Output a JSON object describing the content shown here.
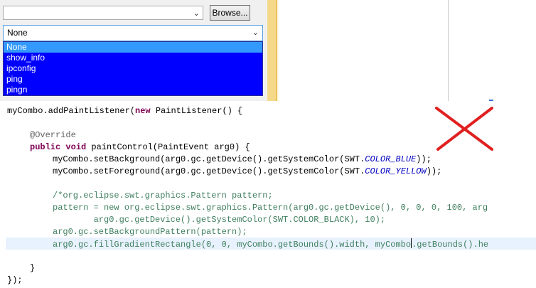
{
  "path_combo": {
    "value": "",
    "arrow": "⌄"
  },
  "browse_button": {
    "label": "Browse..."
  },
  "command_combo": {
    "selected": "None",
    "arrow": "⌄",
    "options": [
      "None",
      "show_info",
      "ipconfig",
      "ping",
      "pingn"
    ]
  },
  "colors": {
    "dropdown_background": "#0000ff",
    "dropdown_text": "#ffffff",
    "highlight": "#3399ff",
    "cross": "#e02020"
  },
  "cross_icon": "x-mark-icon",
  "code": {
    "line1": {
      "a": "myCombo.addPaintListener(",
      "kw": "new",
      "b": " PaintListener() {"
    },
    "line3": {
      "ann": "@Override"
    },
    "line4": {
      "kw1": "public",
      "kw2": "void",
      "b": " paintControl(PaintEvent arg0) {"
    },
    "line5": {
      "a": "myCombo.setBackground(arg0.gc.getDevice().getSystemColor(SWT.",
      "c": "COLOR_BLUE",
      "b": "));"
    },
    "line6": {
      "a": "myCombo.setForeground(arg0.gc.getDevice().getSystemColor(SWT.",
      "c": "COLOR_YELLOW",
      "b": "));"
    },
    "line8": "/*org.eclipse.swt.graphics.Pattern pattern;",
    "line9": "pattern = new org.eclipse.swt.graphics.Pattern(arg0.gc.getDevice(), 0, 0, 0, 100, arg",
    "line10": "        arg0.gc.getDevice().getSystemColor(SWT.COLOR_BLACK), 10);",
    "line11": "arg0.gc.setBackgroundPattern(pattern);",
    "line12": {
      "a": "arg0.gc.fillGradientRectangle(0, 0, myCombo.getBounds().width, myCombo",
      "b": ".getBounds().he"
    },
    "line14": "}",
    "line15": "});"
  }
}
